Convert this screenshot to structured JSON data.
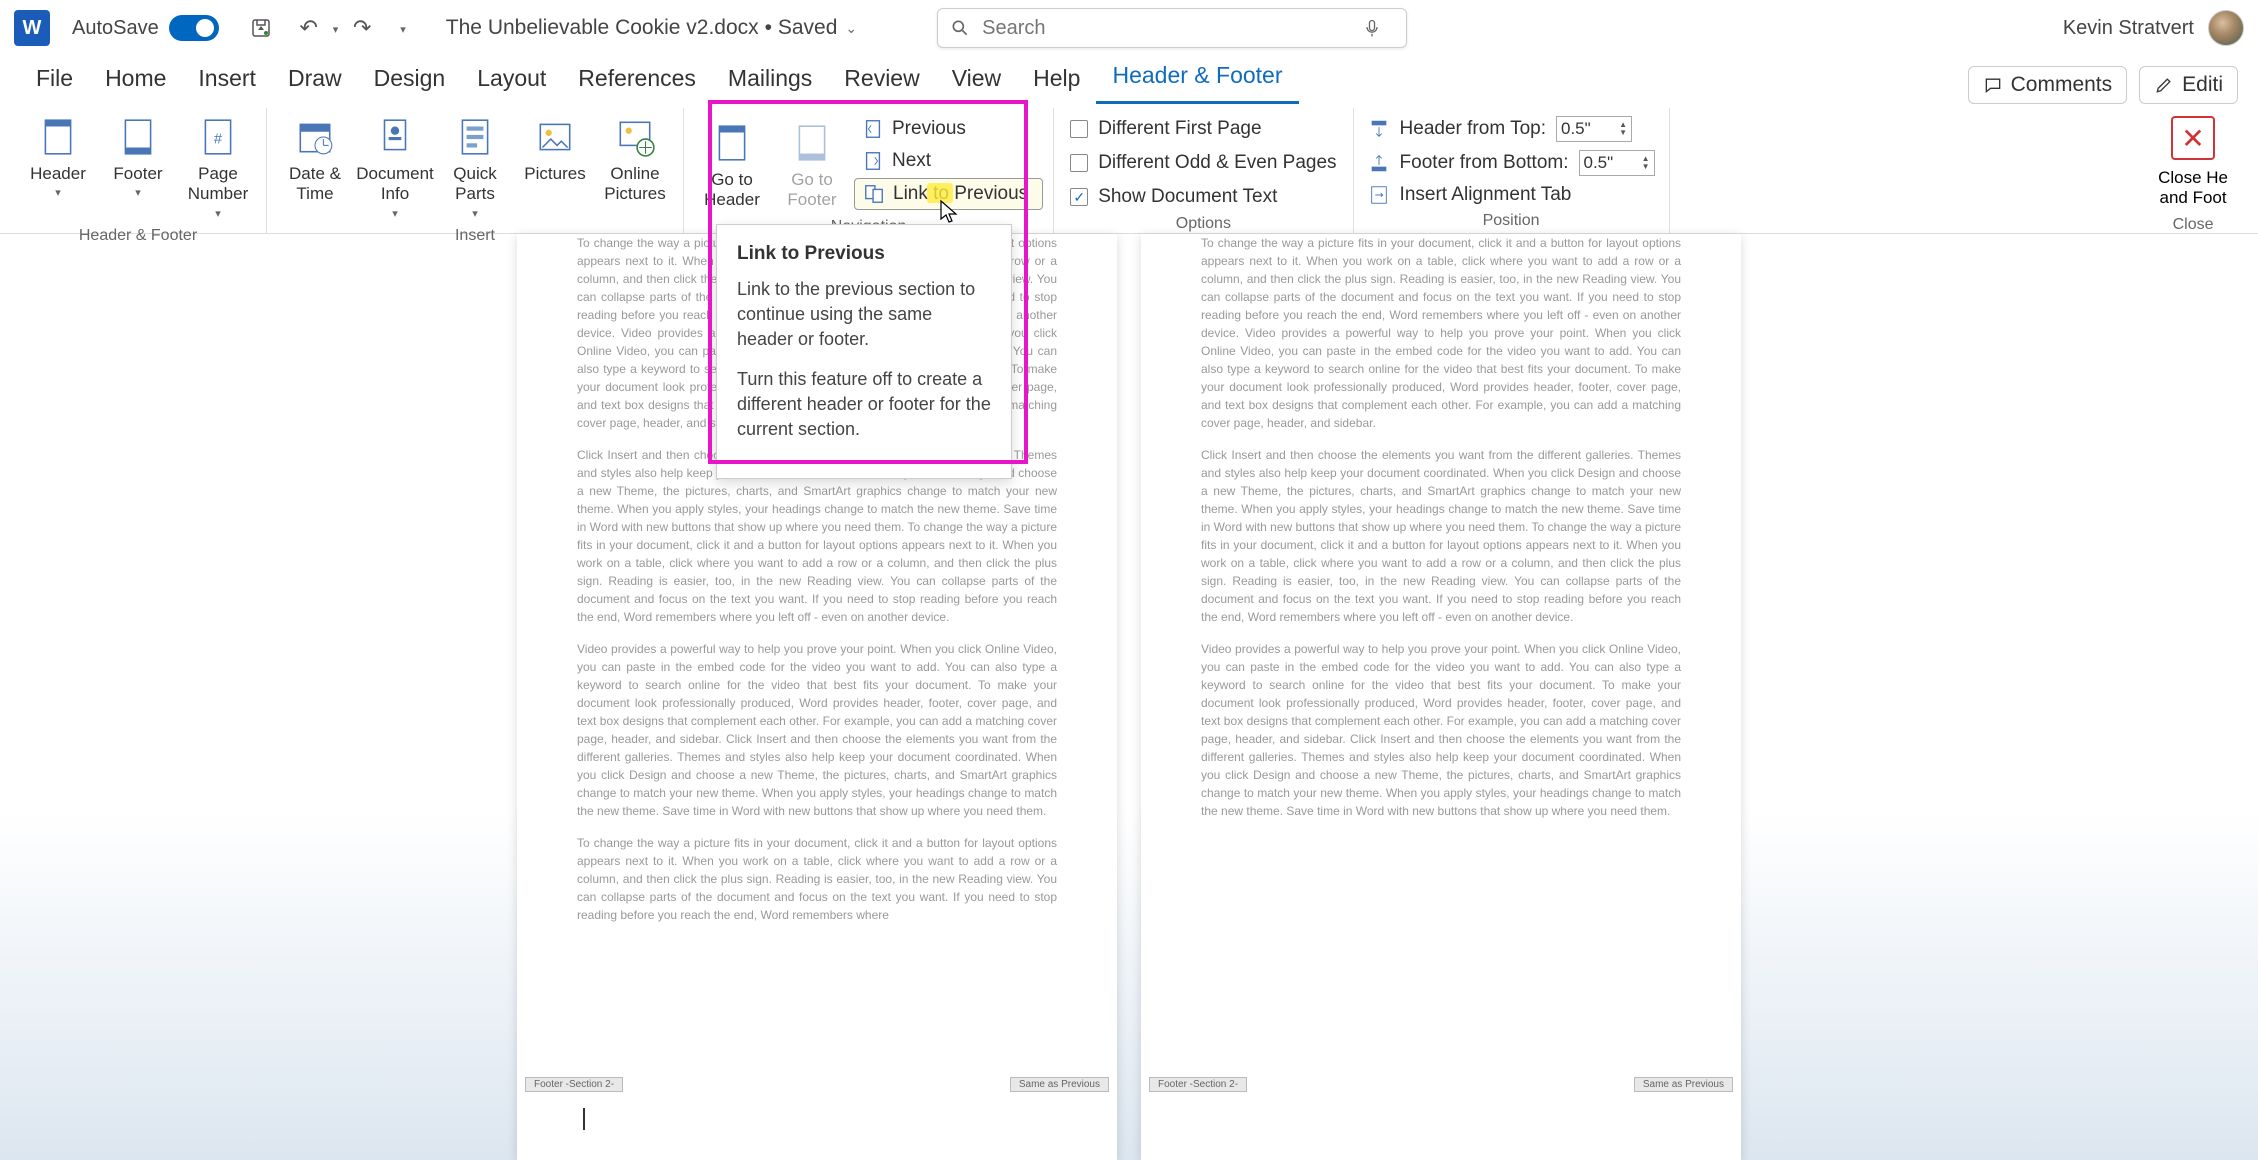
{
  "titlebar": {
    "app_letter": "W",
    "autosave": "AutoSave",
    "filename": "The Unbelievable Cookie v2.docx",
    "saved_status": "• Saved",
    "search_placeholder": "Search",
    "user": "Kevin Stratvert"
  },
  "tabs": {
    "items": [
      "File",
      "Home",
      "Insert",
      "Draw",
      "Design",
      "Layout",
      "References",
      "Mailings",
      "Review",
      "View",
      "Help",
      "Header & Footer"
    ],
    "active_index": 11,
    "comments": "Comments",
    "editing": "Editi"
  },
  "ribbon": {
    "group_hf": {
      "header": "Header",
      "footer": "Footer",
      "page_number": "Page Number",
      "label": "Header & Footer"
    },
    "group_insert": {
      "date_time": "Date & Time",
      "doc_info": "Document Info",
      "quick_parts": "Quick Parts",
      "pictures": "Pictures",
      "online_pics": "Online Pictures",
      "label": "Insert"
    },
    "group_nav": {
      "goto_header": "Go to Header",
      "goto_footer": "Go to Footer",
      "previous": "Previous",
      "next": "Next",
      "link_to_previous": "Link to Previous",
      "label": "Navigation"
    },
    "group_options": {
      "diff_first": "Different First Page",
      "diff_odd_even": "Different Odd & Even Pages",
      "show_doc_text": "Show Document Text",
      "label": "Options"
    },
    "group_position": {
      "header_from_top": "Header from Top:",
      "header_val": "0.5\"",
      "footer_from_bottom": "Footer from Bottom:",
      "footer_val": "0.5\"",
      "insert_align_tab": "Insert Alignment Tab",
      "label": "Position"
    },
    "group_close": {
      "close": "Close He",
      "close2": "and Foot",
      "label": "Close"
    }
  },
  "tooltip": {
    "title": "Link to Previous",
    "p1": "Link to the previous section to continue using the same header or footer.",
    "p2": "Turn this feature off to create a different header or footer for the current section."
  },
  "document": {
    "filler1": "To change the way a picture fits in your document, click it and a button for layout options appears next to it. When you work on a table, click where you want to add a row or a column, and then click the plus sign. Reading is easier, too, in the new Reading view. You can collapse parts of the document and focus on the text you want. If you need to stop reading before you reach the end, Word remembers where you left off - even on another device. Video provides a powerful way to help you prove your point. When you click Online Video, you can paste in the embed code for the video you want to add. You can also type a keyword to search online for the video that best fits your document. To make your document look professionally produced, Word provides header, footer, cover page, and text box designs that complement each other. For example, you can add a matching cover page, header, and sidebar.",
    "filler2": "Click Insert and then choose the elements you want from the different galleries. Themes and styles also help keep your document coordinated. When you click Design and choose a new Theme, the pictures, charts, and SmartArt graphics change to match your new theme. When you apply styles, your headings change to match the new theme. Save time in Word with new buttons that show up where you need them. To change the way a picture fits in your document, click it and a button for layout options appears next to it. When you work on a table, click where you want to add a row or a column, and then click the plus sign. Reading is easier, too, in the new Reading view. You can collapse parts of the document and focus on the text you want. If you need to stop reading before you reach the end, Word remembers where you left off - even on another device.",
    "filler3": "Video provides a powerful way to help you prove your point. When you click Online Video, you can paste in the embed code for the video you want to add. You can also type a keyword to search online for the video that best fits your document. To make your document look professionally produced, Word provides header, footer, cover page, and text box designs that complement each other. For example, you can add a matching cover page, header, and sidebar. Click Insert and then choose the elements you want from the different galleries. Themes and styles also help keep your document coordinated. When you click Design and choose a new Theme, the pictures, charts, and SmartArt graphics change to match your new theme. When you apply styles, your headings change to match the new theme. Save time in Word with new buttons that show up where you need them.",
    "filler4": "To change the way a picture fits in your document, click it and a button for layout options appears next to it. When you work on a table, click where you want to add a row or a column, and then click the plus sign. Reading is easier, too, in the new Reading view. You can collapse parts of the document and focus on the text you want. If you need to stop reading before you reach the end, Word remembers where",
    "footer_left": "Footer -Section 2-",
    "footer_right": "Same as Previous"
  }
}
